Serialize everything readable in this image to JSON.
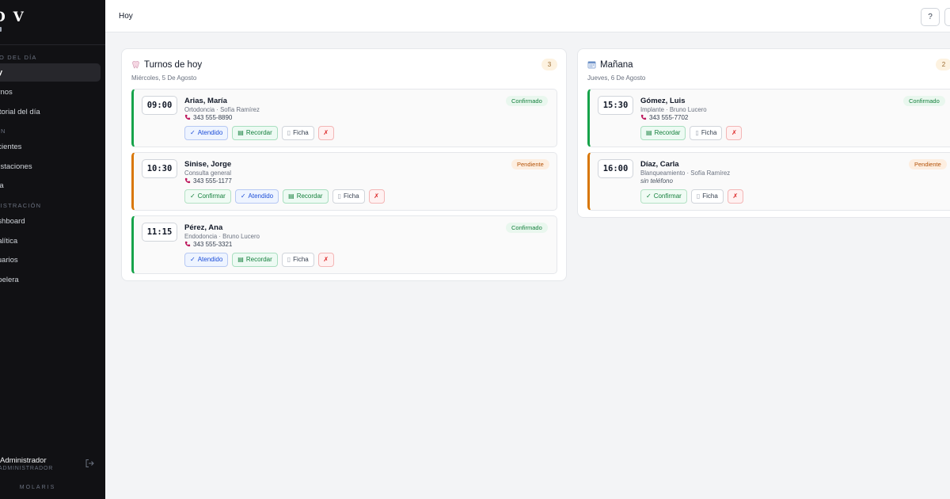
{
  "sidebar": {
    "brand": "D V",
    "sections": [
      {
        "label": "JO DEL DÍA"
      },
      {
        "label": "ÓN"
      },
      {
        "label": "NISTRACIÓN"
      }
    ],
    "items": [
      {
        "label": "oy",
        "active": true
      },
      {
        "label": "urnos"
      },
      {
        "label": "istorial del día"
      },
      {
        "label": "acientes"
      },
      {
        "label": "restaciones"
      },
      {
        "label": "aja"
      },
      {
        "label": "ashboard"
      },
      {
        "label": "nalítica"
      },
      {
        "label": "suarios"
      },
      {
        "label": "apelera"
      }
    ],
    "user": {
      "name": "Administrador",
      "role": "ADMINISTRADOR"
    },
    "footer": "MOLARIS"
  },
  "topbar": {
    "title": "Hoy",
    "help": "?"
  },
  "today": {
    "title": "Turnos de hoy",
    "date": "Miércoles, 5 De Agosto",
    "count": "3",
    "appointments": [
      {
        "time": "09:00",
        "patient": "Arias, María",
        "treatment": "Ortodoncia · Sofía Ramírez",
        "phone": "343 555-8890",
        "status": "Confirmado",
        "actions": [
          "Atendido",
          "Recordar",
          "Ficha",
          "✗"
        ]
      },
      {
        "time": "10:30",
        "patient": "Sinise, Jorge",
        "treatment": "Consulta general",
        "phone": "343 555-1177",
        "status": "Pendiente",
        "actions": [
          "Confirmar",
          "Atendido",
          "Recordar",
          "Ficha",
          "✗"
        ]
      },
      {
        "time": "11:15",
        "patient": "Pérez, Ana",
        "treatment": "Endodoncia · Bruno Lucero",
        "phone": "343 555-3321",
        "status": "Confirmado",
        "actions": [
          "Atendido",
          "Recordar",
          "Ficha",
          "✗"
        ]
      }
    ]
  },
  "tomorrow": {
    "title": "Mañana",
    "date": "Jueves, 6 De Agosto",
    "count": "2",
    "appointments": [
      {
        "time": "15:30",
        "patient": "Gómez, Luis",
        "treatment": "Implante · Bruno Lucero",
        "phone": "343 555-7702",
        "status": "Confirmado",
        "actions": [
          "Recordar",
          "Ficha",
          "✗"
        ]
      },
      {
        "time": "16:00",
        "patient": "Díaz, Carla",
        "treatment": "Blanqueamiento · Sofía Ramírez",
        "phone": "sin teléfono",
        "status": "Pendiente",
        "actions": [
          "Confirmar",
          "Ficha",
          "✗"
        ]
      }
    ]
  },
  "colors": {
    "confirmed": "#16a34a",
    "pending": "#d97706",
    "sidebar": "#111114"
  }
}
